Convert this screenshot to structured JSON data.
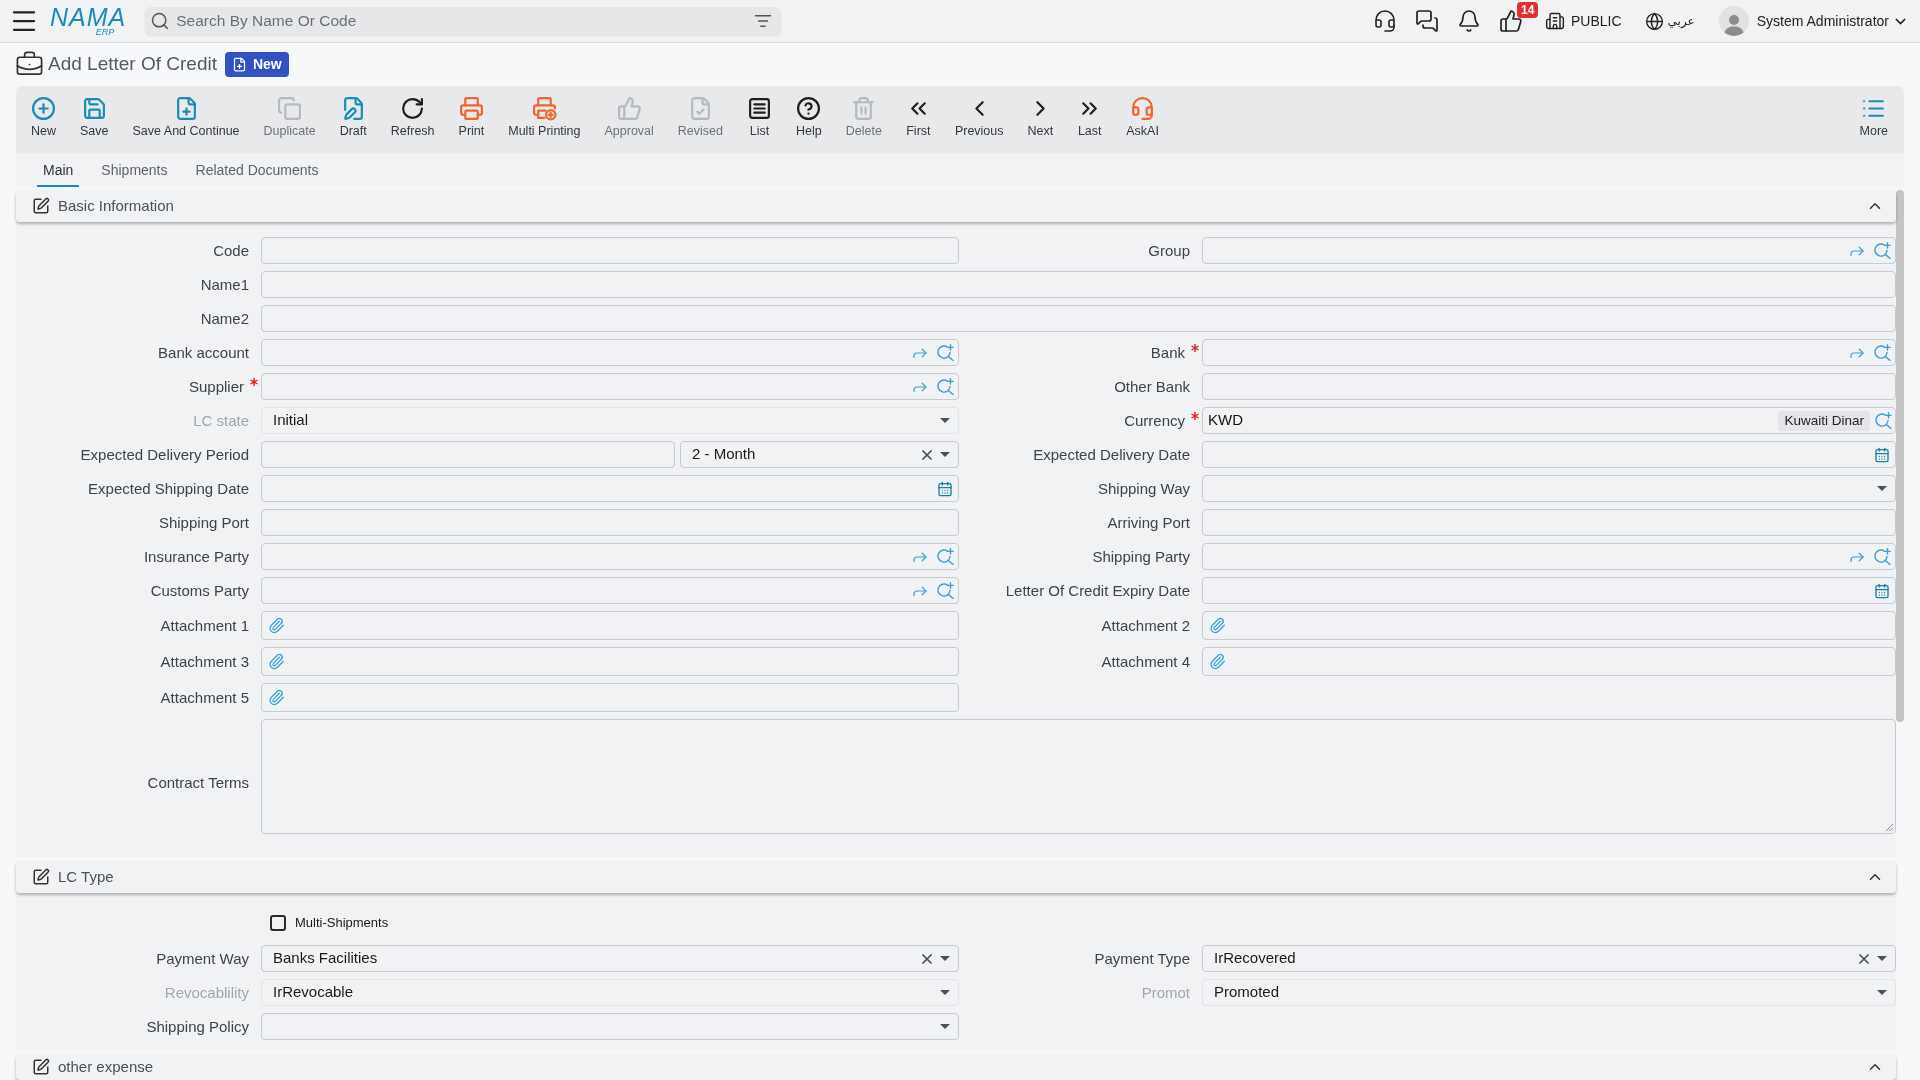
{
  "top_bar": {
    "logo": {
      "name": "NAMA",
      "suffix": "ERP"
    },
    "search": {
      "placeholder": "Search By Name Or Code"
    },
    "badge_count": "14",
    "company": "PUBLIC",
    "language": "عربي",
    "user": "System Administrator"
  },
  "page": {
    "title": "Add Letter Of Credit",
    "badge": "New"
  },
  "toolbar": [
    {
      "label": "New",
      "color": "#1b8bb4",
      "disabled": false
    },
    {
      "label": "Save",
      "color": "#1b8bb4",
      "disabled": false
    },
    {
      "label": "Save And Continue",
      "color": "#1b8bb4",
      "disabled": false
    },
    {
      "label": "Duplicate",
      "disabled": true
    },
    {
      "label": "Draft",
      "color": "#1b8bb4",
      "disabled": false
    },
    {
      "label": "Refresh",
      "color": "#1f1f1f",
      "disabled": false
    },
    {
      "label": "Print",
      "color": "#f0652f",
      "disabled": false
    },
    {
      "label": "Multi Printing",
      "color": "#f0652f",
      "disabled": false
    },
    {
      "label": "Approval",
      "disabled": true
    },
    {
      "label": "Revised",
      "disabled": true
    },
    {
      "label": "List",
      "color": "#1f1f1f",
      "disabled": false
    },
    {
      "label": "Help",
      "color": "#1f1f1f",
      "disabled": false
    },
    {
      "label": "Delete",
      "disabled": true
    },
    {
      "label": "First",
      "color": "#1f1f1f",
      "disabled": false
    },
    {
      "label": "Previous",
      "color": "#1f1f1f",
      "disabled": false
    },
    {
      "label": "Next",
      "color": "#1f1f1f",
      "disabled": false
    },
    {
      "label": "Last",
      "color": "#1f1f1f",
      "disabled": false
    },
    {
      "label": "AskAI",
      "color": "#f0652f",
      "disabled": false
    }
  ],
  "more_button": {
    "label": "More",
    "color": "#1b8bb4"
  },
  "tabs": [
    {
      "label": "Main",
      "selected": true
    },
    {
      "label": "Shipments",
      "selected": false
    },
    {
      "label": "Related Documents",
      "selected": false
    }
  ],
  "sections": [
    {
      "title": "Basic Information",
      "expanded": true,
      "rows": [
        {
          "kind": "pair",
          "fields": [
            {
              "label": "Code",
              "kind": "text",
              "required": false,
              "disabled": false
            },
            {
              "label": "Group",
              "kind": "lookup",
              "required": false,
              "disabled": false
            }
          ]
        },
        {
          "kind": "wide",
          "fields": [
            {
              "label": "Name1",
              "kind": "text",
              "required": false,
              "disabled": false
            }
          ]
        },
        {
          "kind": "wide",
          "fields": [
            {
              "label": "Name2",
              "kind": "text",
              "required": false,
              "disabled": false
            }
          ]
        },
        {
          "kind": "pair",
          "fields": [
            {
              "label": "Bank account",
              "kind": "lookup",
              "required": false,
              "disabled": false
            },
            {
              "label": "Bank",
              "kind": "lookup",
              "required": true,
              "disabled": false
            }
          ]
        },
        {
          "kind": "pair",
          "fields": [
            {
              "label": "Supplier",
              "kind": "lookup",
              "required": true,
              "disabled": false
            },
            {
              "label": "Other Bank",
              "kind": "text",
              "required": false,
              "disabled": false
            }
          ]
        },
        {
          "kind": "pair",
          "fields": [
            {
              "label": "LC state",
              "kind": "select",
              "value": "Initial",
              "clearable": false,
              "required": false,
              "disabled": true
            },
            {
              "label": "Currency",
              "kind": "currency",
              "value": "KWD",
              "tag": "Kuwaiti Dinar",
              "required": true,
              "disabled": false
            }
          ]
        },
        {
          "kind": "pair",
          "fields": [
            {
              "label": "Expected Delivery Period",
              "kind": "period",
              "unit": "2 - Month",
              "clearable": true,
              "required": false,
              "disabled": false
            },
            {
              "label": "Expected Delivery Date",
              "kind": "date",
              "required": false,
              "disabled": false
            }
          ]
        },
        {
          "kind": "pair",
          "fields": [
            {
              "label": "Expected Shipping Date",
              "kind": "date",
              "required": false,
              "disabled": false
            },
            {
              "label": "Shipping Way",
              "kind": "select",
              "clearable": false,
              "required": false,
              "disabled": false
            }
          ]
        },
        {
          "kind": "pair",
          "fields": [
            {
              "label": "Shipping Port",
              "kind": "text",
              "required": false,
              "disabled": false
            },
            {
              "label": "Arriving Port",
              "kind": "text",
              "required": false,
              "disabled": false
            }
          ]
        },
        {
          "kind": "pair",
          "fields": [
            {
              "label": "Insurance Party",
              "kind": "lookup",
              "required": false,
              "disabled": false
            },
            {
              "label": "Shipping Party",
              "kind": "lookup",
              "required": false,
              "disabled": false
            }
          ]
        },
        {
          "kind": "pair",
          "fields": [
            {
              "label": "Customs Party",
              "kind": "lookup",
              "required": false,
              "disabled": false
            },
            {
              "label": "Letter Of Credit Expiry Date",
              "kind": "date",
              "required": false,
              "disabled": false
            }
          ]
        },
        {
          "kind": "pair",
          "fields": [
            {
              "label": "Attachment 1",
              "kind": "attachment",
              "required": false,
              "disabled": false
            },
            {
              "label": "Attachment 2",
              "kind": "attachment",
              "required": false,
              "disabled": false
            }
          ]
        },
        {
          "kind": "pair",
          "fields": [
            {
              "label": "Attachment 3",
              "kind": "attachment",
              "required": false,
              "disabled": false
            },
            {
              "label": "Attachment 4",
              "kind": "attachment",
              "required": false,
              "disabled": false
            }
          ]
        },
        {
          "kind": "pair",
          "fields": [
            {
              "label": "Attachment 5",
              "kind": "attachment",
              "required": false,
              "disabled": false
            }
          ]
        },
        {
          "kind": "wide",
          "fields": [
            {
              "label": "Contract Terms",
              "kind": "textarea",
              "required": false,
              "disabled": false
            }
          ]
        }
      ]
    },
    {
      "title": "LC Type",
      "expanded": true,
      "rows": [
        {
          "kind": "pair",
          "fields": [
            {
              "label": "Multi-Shipments",
              "kind": "checkbox",
              "checked": false,
              "required": false,
              "disabled": false
            }
          ]
        },
        {
          "kind": "pair",
          "fields": [
            {
              "label": "Payment Way",
              "kind": "select",
              "value": "Banks Facilities",
              "clearable": true,
              "required": false,
              "disabled": false
            },
            {
              "label": "Payment Type",
              "kind": "select",
              "value": "IrRecovered",
              "clearable": true,
              "required": false,
              "disabled": false
            }
          ]
        },
        {
          "kind": "pair",
          "fields": [
            {
              "label": "Revocablility",
              "kind": "select",
              "value": "IrRevocable",
              "clearable": false,
              "required": false,
              "disabled": true
            },
            {
              "label": "Promot",
              "kind": "select",
              "value": "Promoted",
              "clearable": false,
              "required": false,
              "disabled": true
            }
          ]
        },
        {
          "kind": "pair",
          "fields": [
            {
              "label": "Shipping Policy",
              "kind": "select",
              "clearable": false,
              "required": false,
              "disabled": false
            }
          ]
        }
      ]
    },
    {
      "title": "other expense",
      "expanded": true
    }
  ]
}
